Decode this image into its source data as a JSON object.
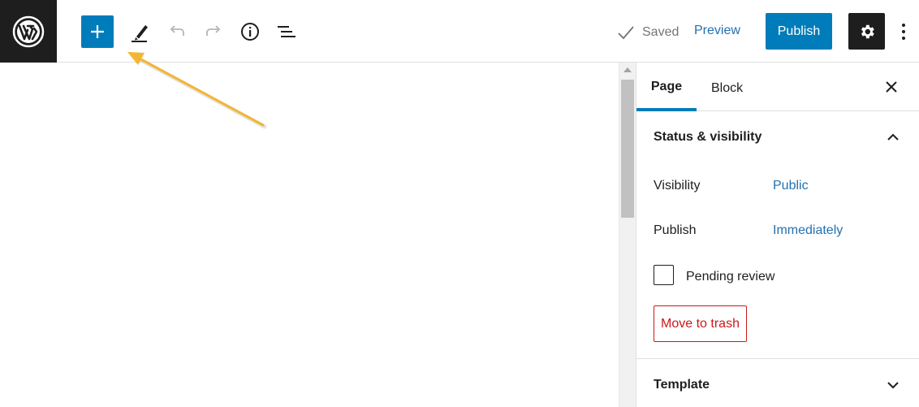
{
  "toolbar": {
    "logo": "wordpress-logo",
    "inserter_icon": "plus-icon",
    "tools_icon": "pencil-icon",
    "undo_icon": "undo-icon",
    "redo_icon": "redo-icon",
    "details_icon": "info-icon",
    "outline_icon": "list-view-icon",
    "saved_label": "Saved",
    "preview_label": "Preview",
    "publish_label": "Publish",
    "settings_icon": "gear-icon",
    "more_icon": "vertical-ellipsis-icon"
  },
  "sidebar": {
    "tabs": [
      {
        "label": "Page",
        "active": true
      },
      {
        "label": "Block",
        "active": false
      }
    ],
    "close_icon": "close-icon",
    "status_section": {
      "title": "Status & visibility",
      "expanded": true,
      "visibility_label": "Visibility",
      "visibility_value": "Public",
      "publish_label": "Publish",
      "publish_value": "Immediately",
      "pending_review_label": "Pending review",
      "pending_review_checked": false,
      "trash_label": "Move to trash"
    },
    "template_section": {
      "title": "Template",
      "expanded": false
    }
  },
  "colors": {
    "accent": "#007cba",
    "link": "#2271b1",
    "danger": "#cc1818",
    "dark": "#1e1e1e",
    "annotation_arrow": "#f2b632"
  }
}
